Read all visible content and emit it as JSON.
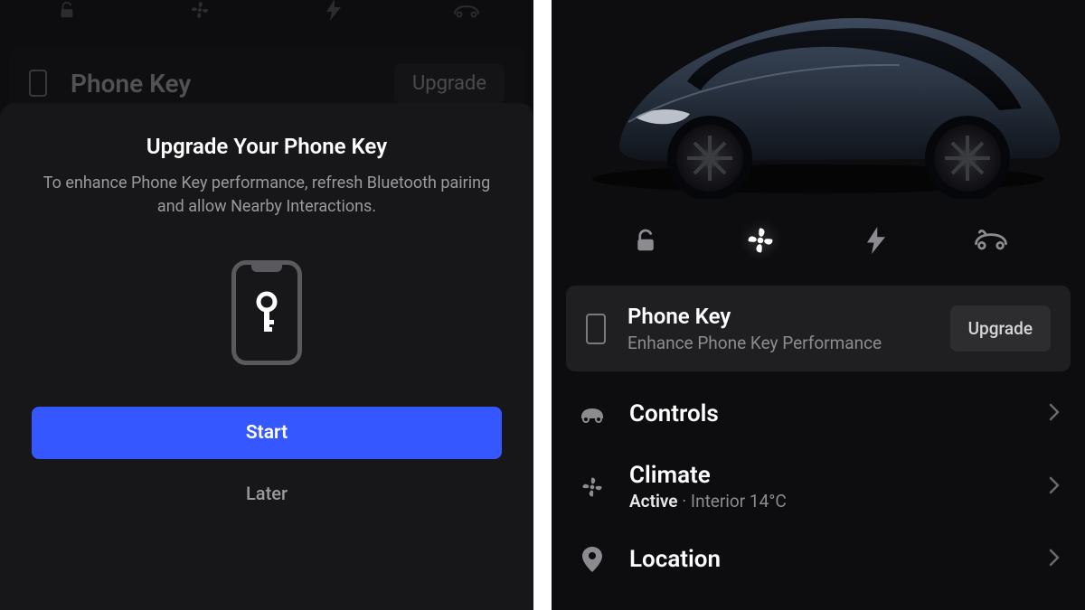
{
  "left": {
    "bg_card": {
      "title": "Phone Key",
      "button": "Upgrade"
    },
    "toolbar_icons": [
      "unlock-icon",
      "fan-icon",
      "bolt-icon",
      "frunk-icon"
    ],
    "sheet": {
      "title": "Upgrade Your Phone Key",
      "body": "To enhance Phone Key performance, refresh Bluetooth pairing and allow Nearby Interactions.",
      "primary": "Start",
      "secondary": "Later"
    }
  },
  "right": {
    "quick_icons": [
      "unlock-icon",
      "fan-icon",
      "bolt-icon",
      "frunk-icon"
    ],
    "active_quick_index": 1,
    "card": {
      "title": "Phone Key",
      "subtitle": "Enhance Phone Key Performance",
      "button": "Upgrade"
    },
    "menu": [
      {
        "title": "Controls",
        "icon": "car-icon"
      },
      {
        "title": "Climate",
        "icon": "fan-icon",
        "sub_strong": "Active",
        "sub_weak": " · Interior 14°C"
      },
      {
        "title": "Location",
        "icon": "pin-icon"
      }
    ]
  }
}
